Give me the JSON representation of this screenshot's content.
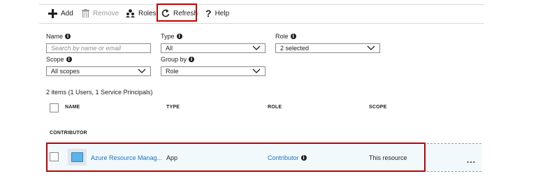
{
  "toolbar": {
    "add_label": "Add",
    "remove_label": "Remove",
    "roles_label": "Roles",
    "refresh_label": "Refresh",
    "help_label": "Help"
  },
  "filters": {
    "name": {
      "label": "Name",
      "placeholder": "Search by name or email"
    },
    "type": {
      "label": "Type",
      "value": "All"
    },
    "role": {
      "label": "Role",
      "value": "2 selected"
    },
    "scope": {
      "label": "Scope",
      "value": "All scopes"
    },
    "group_by": {
      "label": "Group by",
      "value": "Role"
    }
  },
  "summary": "2 items (1 Users, 1 Service Principals)",
  "table": {
    "headers": [
      "NAME",
      "TYPE",
      "ROLE",
      "SCOPE"
    ],
    "group_label": "CONTRIBUTOR",
    "rows": [
      {
        "name": "Azure Resource Manag...",
        "type": "App",
        "role": "Contributor",
        "scope": "This resource",
        "more": "..."
      }
    ]
  },
  "colors": {
    "link": "#1a73c9",
    "highlight": "#c00000",
    "row_bg": "#f2f9fc"
  },
  "icons": {
    "add": "plus-icon",
    "remove": "trash-icon",
    "roles": "people-icon",
    "refresh": "refresh-icon",
    "help": "question-icon",
    "info": "info-icon",
    "chevron": "chevron-down-icon",
    "app": "app-icon",
    "more": "ellipsis-icon"
  }
}
